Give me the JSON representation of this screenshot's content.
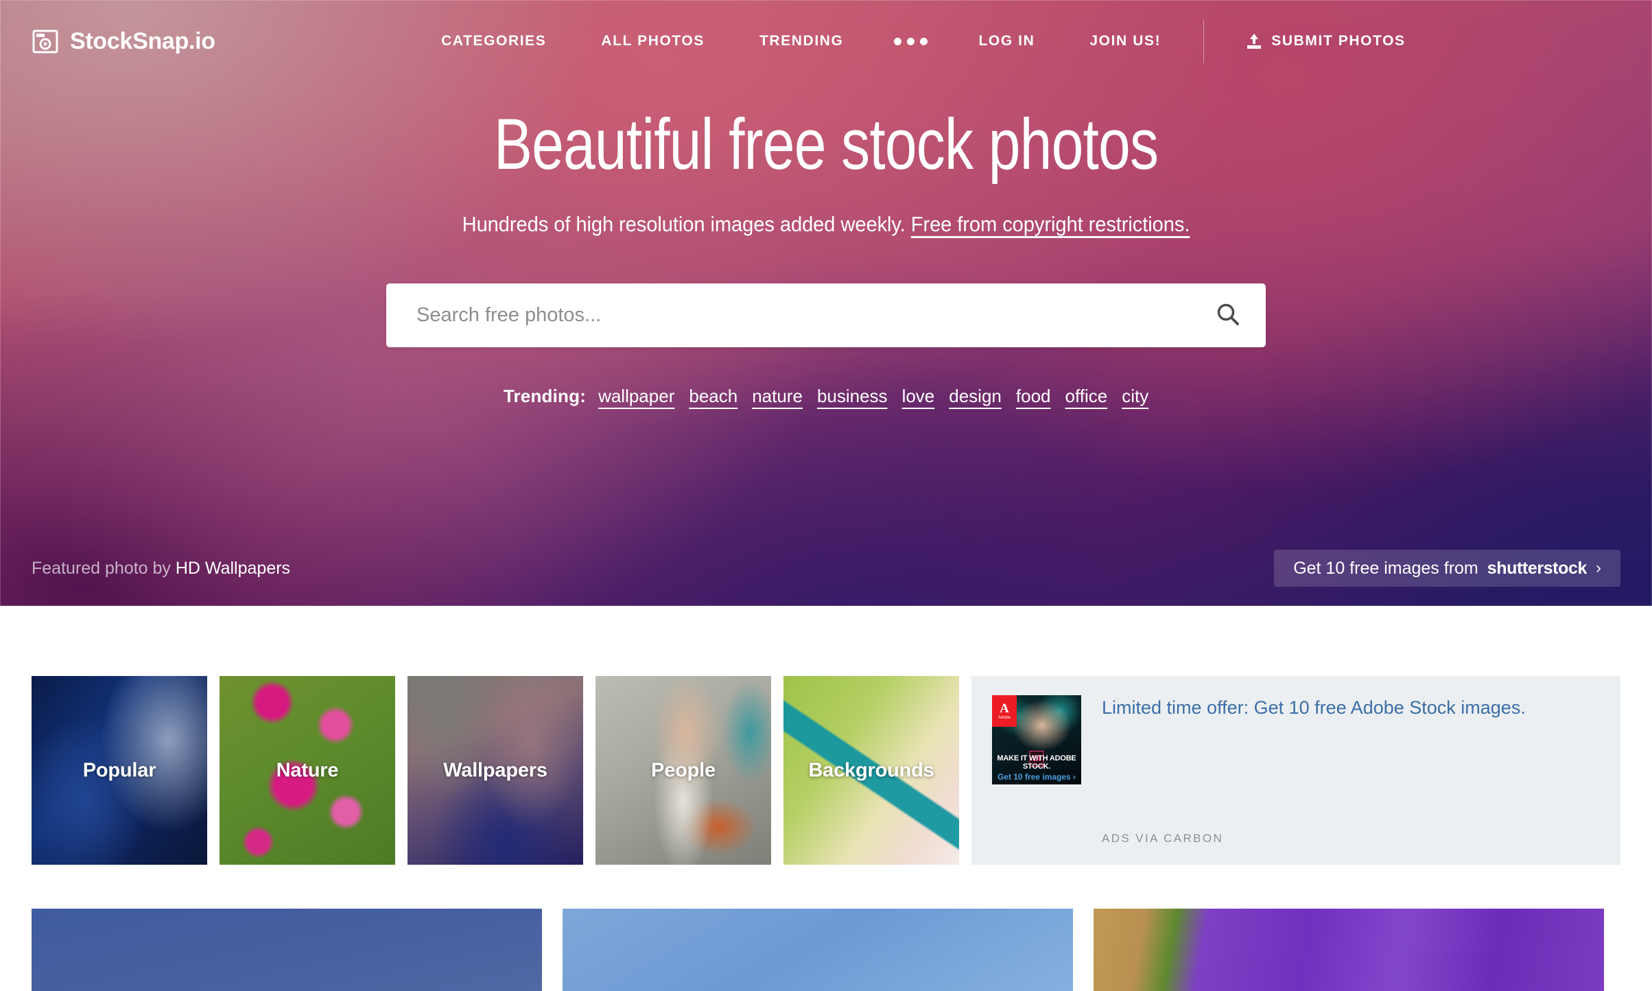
{
  "brand": {
    "name": "StockSnap.io",
    "icon": "camera-icon"
  },
  "nav": {
    "center": [
      {
        "label": "CATEGORIES",
        "name": "categories"
      },
      {
        "label": "ALL PHOTOS",
        "name": "all-photos"
      },
      {
        "label": "TRENDING",
        "name": "trending"
      }
    ],
    "more_icon": "ellipsis-icon",
    "right": [
      {
        "label": "LOG IN",
        "name": "log-in"
      },
      {
        "label": "JOIN US!",
        "name": "join-us"
      }
    ],
    "submit": {
      "label": "SUBMIT PHOTOS",
      "icon": "upload-icon"
    }
  },
  "hero": {
    "title": "Beautiful free stock photos",
    "subtitle_text": "Hundreds of high resolution images added weekly.",
    "subtitle_link": "Free from copyright restrictions.",
    "search": {
      "placeholder": "Search free photos...",
      "value": "",
      "icon": "search-icon"
    },
    "trending_label": "Trending:",
    "trending_tags": [
      "wallpaper",
      "beach",
      "nature",
      "business",
      "love",
      "design",
      "food",
      "office",
      "city"
    ],
    "featured_prefix": "Featured photo by",
    "featured_author": "HD Wallpapers",
    "shutterstock": {
      "text": "Get 10 free images from",
      "brand": "shutterstock",
      "chevron": "chevron-right-icon"
    }
  },
  "categories": [
    {
      "label": "Popular",
      "name": "popular"
    },
    {
      "label": "Nature",
      "name": "nature"
    },
    {
      "label": "Wallpapers",
      "name": "wallpapers"
    },
    {
      "label": "People",
      "name": "people"
    },
    {
      "label": "Backgrounds",
      "name": "backgrounds"
    }
  ],
  "ad": {
    "headline": "Limited time offer: Get 10 free Adobe Stock images.",
    "via": "ADS VIA CARBON",
    "creative": {
      "brand": "Adobe",
      "brand_mark": "A",
      "product_mark": "St",
      "overlay_line1": "MAKE IT WITH ADOBE STOCK.",
      "overlay_line2": "Get 10 free images ›"
    }
  },
  "colors": {
    "hero_top": "#b4707f",
    "hero_mid": "#b5506b",
    "hero_bottom_left": "#51134f",
    "hero_bottom_right": "#231a63",
    "ad_bg": "#eceff1",
    "ad_link": "#3b6ea8",
    "adobe_red": "#ec1c24"
  }
}
